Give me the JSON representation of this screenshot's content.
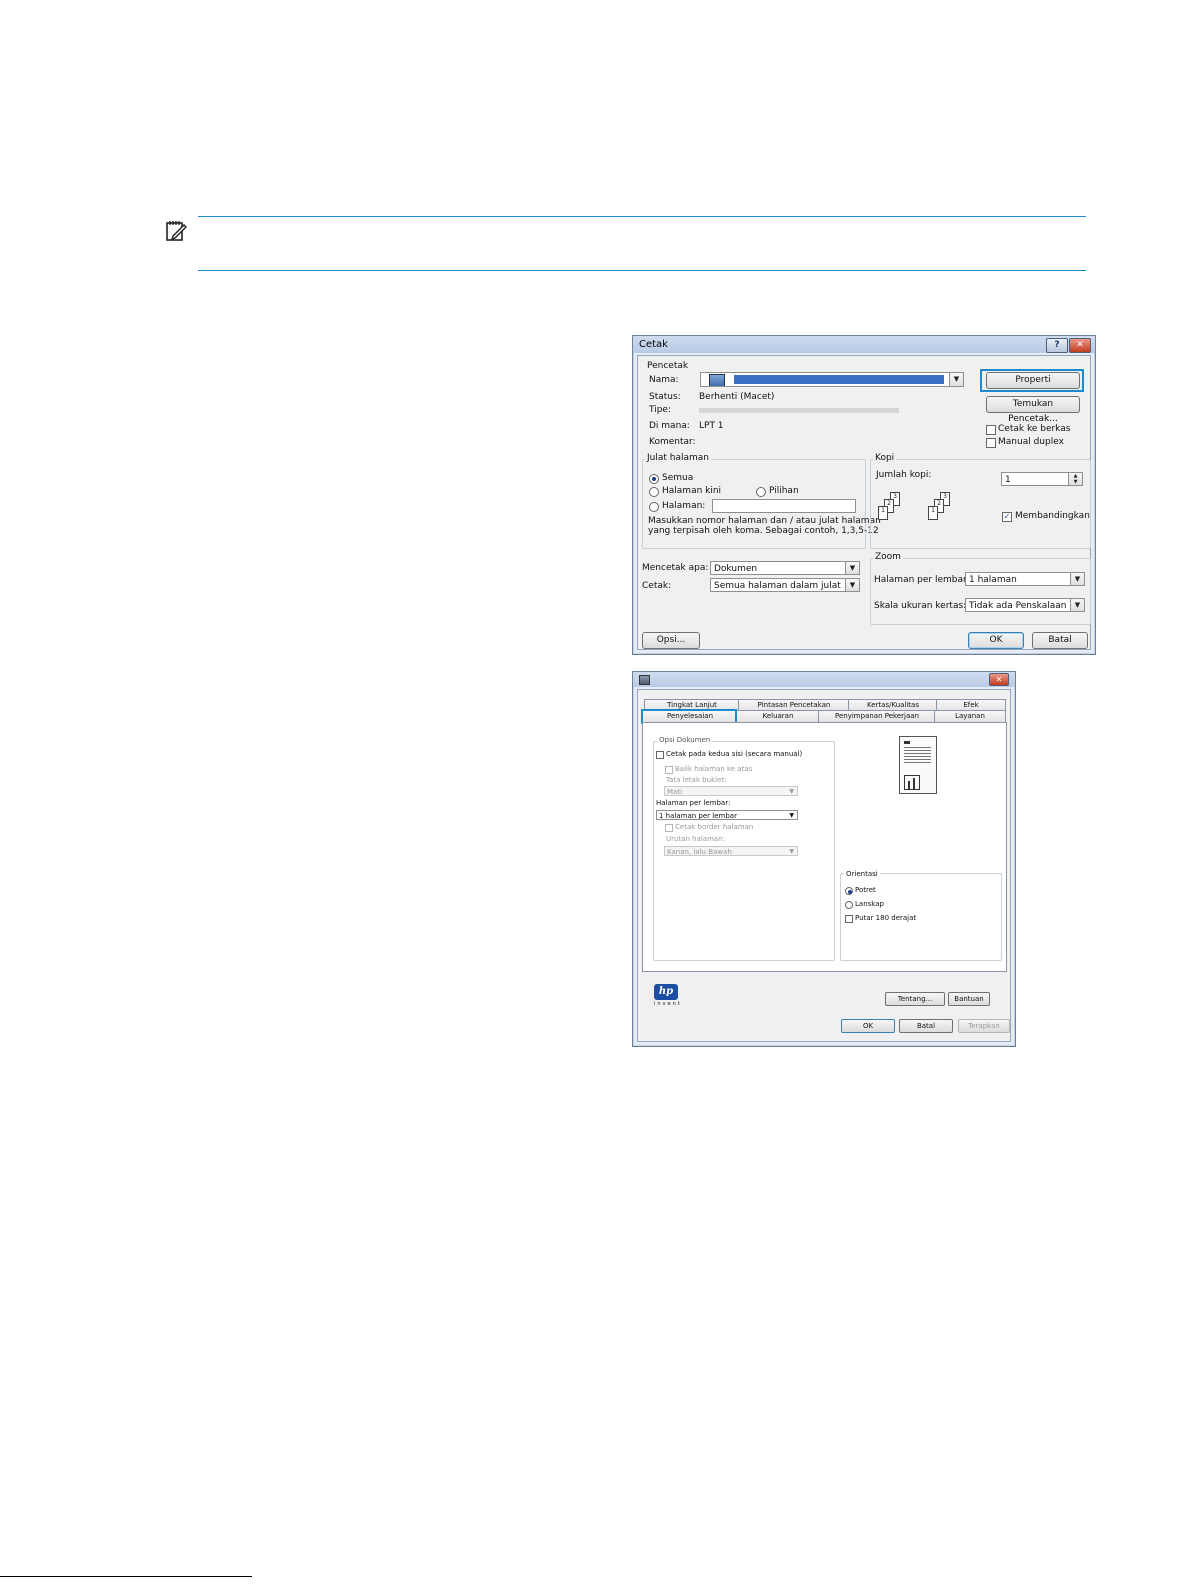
{
  "print_dialog": {
    "title": "Cetak",
    "printer_group": "Pencetak",
    "name_label": "Nama:",
    "status_label": "Status:",
    "status_value": "Berhenti (Macet)",
    "type_label": "Tipe:",
    "location_label": "Di mana:",
    "location_value": "LPT 1",
    "comment_label": "Komentar:",
    "properties_button": "Properti",
    "find_printer_button": "Temukan Pencetak...",
    "print_to_file": "Cetak ke berkas",
    "manual_duplex": "Manual duplex",
    "range_group": "Julat halaman",
    "range_all": "Semua",
    "range_current": "Halaman kini",
    "range_selection": "Pilihan",
    "range_pages": "Halaman:",
    "range_hint_1": "Masukkan nomor halaman dan / atau julat halaman",
    "range_hint_2": "yang terpisah oleh koma. Sebagai contoh, 1,3,5-12",
    "copies_group": "Kopi",
    "copies_label": "Jumlah kopi:",
    "copies_value": "1",
    "collate_label": "Membandingkan",
    "print_what_label": "Mencetak apa:",
    "print_what_value": "Dokumen",
    "print_label": "Cetak:",
    "print_value": "Semua halaman dalam julat",
    "zoom_group": "Zoom",
    "pages_per_sheet_label": "Halaman per lembar:",
    "pages_per_sheet_value": "1 halaman",
    "scale_label": "Skala ukuran kertas:",
    "scale_value": "Tidak ada Penskalaan",
    "options_button": "Opsi...",
    "ok_button": "OK",
    "cancel_button": "Batal",
    "page_icons": [
      "1",
      "2",
      "3"
    ]
  },
  "properties_dialog": {
    "tabs_back": [
      "Tingkat Lanjut",
      "Pintasan Pencetakan",
      "Kertas/Kualitas",
      "Efek"
    ],
    "tabs_front": [
      "Penyelesaian",
      "Keluaran",
      "Penyimpanan Pekerjaan",
      "Layanan"
    ],
    "doc_options_group": "Opsi Dokumen",
    "duplex_manual": "Cetak pada kedua sisi (secara manual)",
    "flip_up": "Balik halaman ke atas",
    "booklet_layout_label": "Tata letak buklet:",
    "booklet_layout_value": "Mati",
    "pages_per_sheet_label": "Halaman per lembar:",
    "pages_per_sheet_value": "1 halaman per lembar",
    "print_page_borders": "Cetak border halaman",
    "page_order_label": "Urutan halaman:",
    "page_order_value": "Kanan, lalu Bawah",
    "orientation_group": "Orientasi",
    "portrait": "Potret",
    "landscape": "Lanskap",
    "rotate_180": "Putar 180 derajat",
    "logo_text": "hp",
    "logo_subtext": "invent",
    "about_button": "Tentang...",
    "help_button": "Bantuan",
    "ok_button": "OK",
    "cancel_button": "Batal",
    "apply_button": "Terapkan"
  },
  "colors": {
    "accent": "#1a8ccc",
    "window_frame": "#b9cbe5",
    "close_button": "#c23b21"
  }
}
